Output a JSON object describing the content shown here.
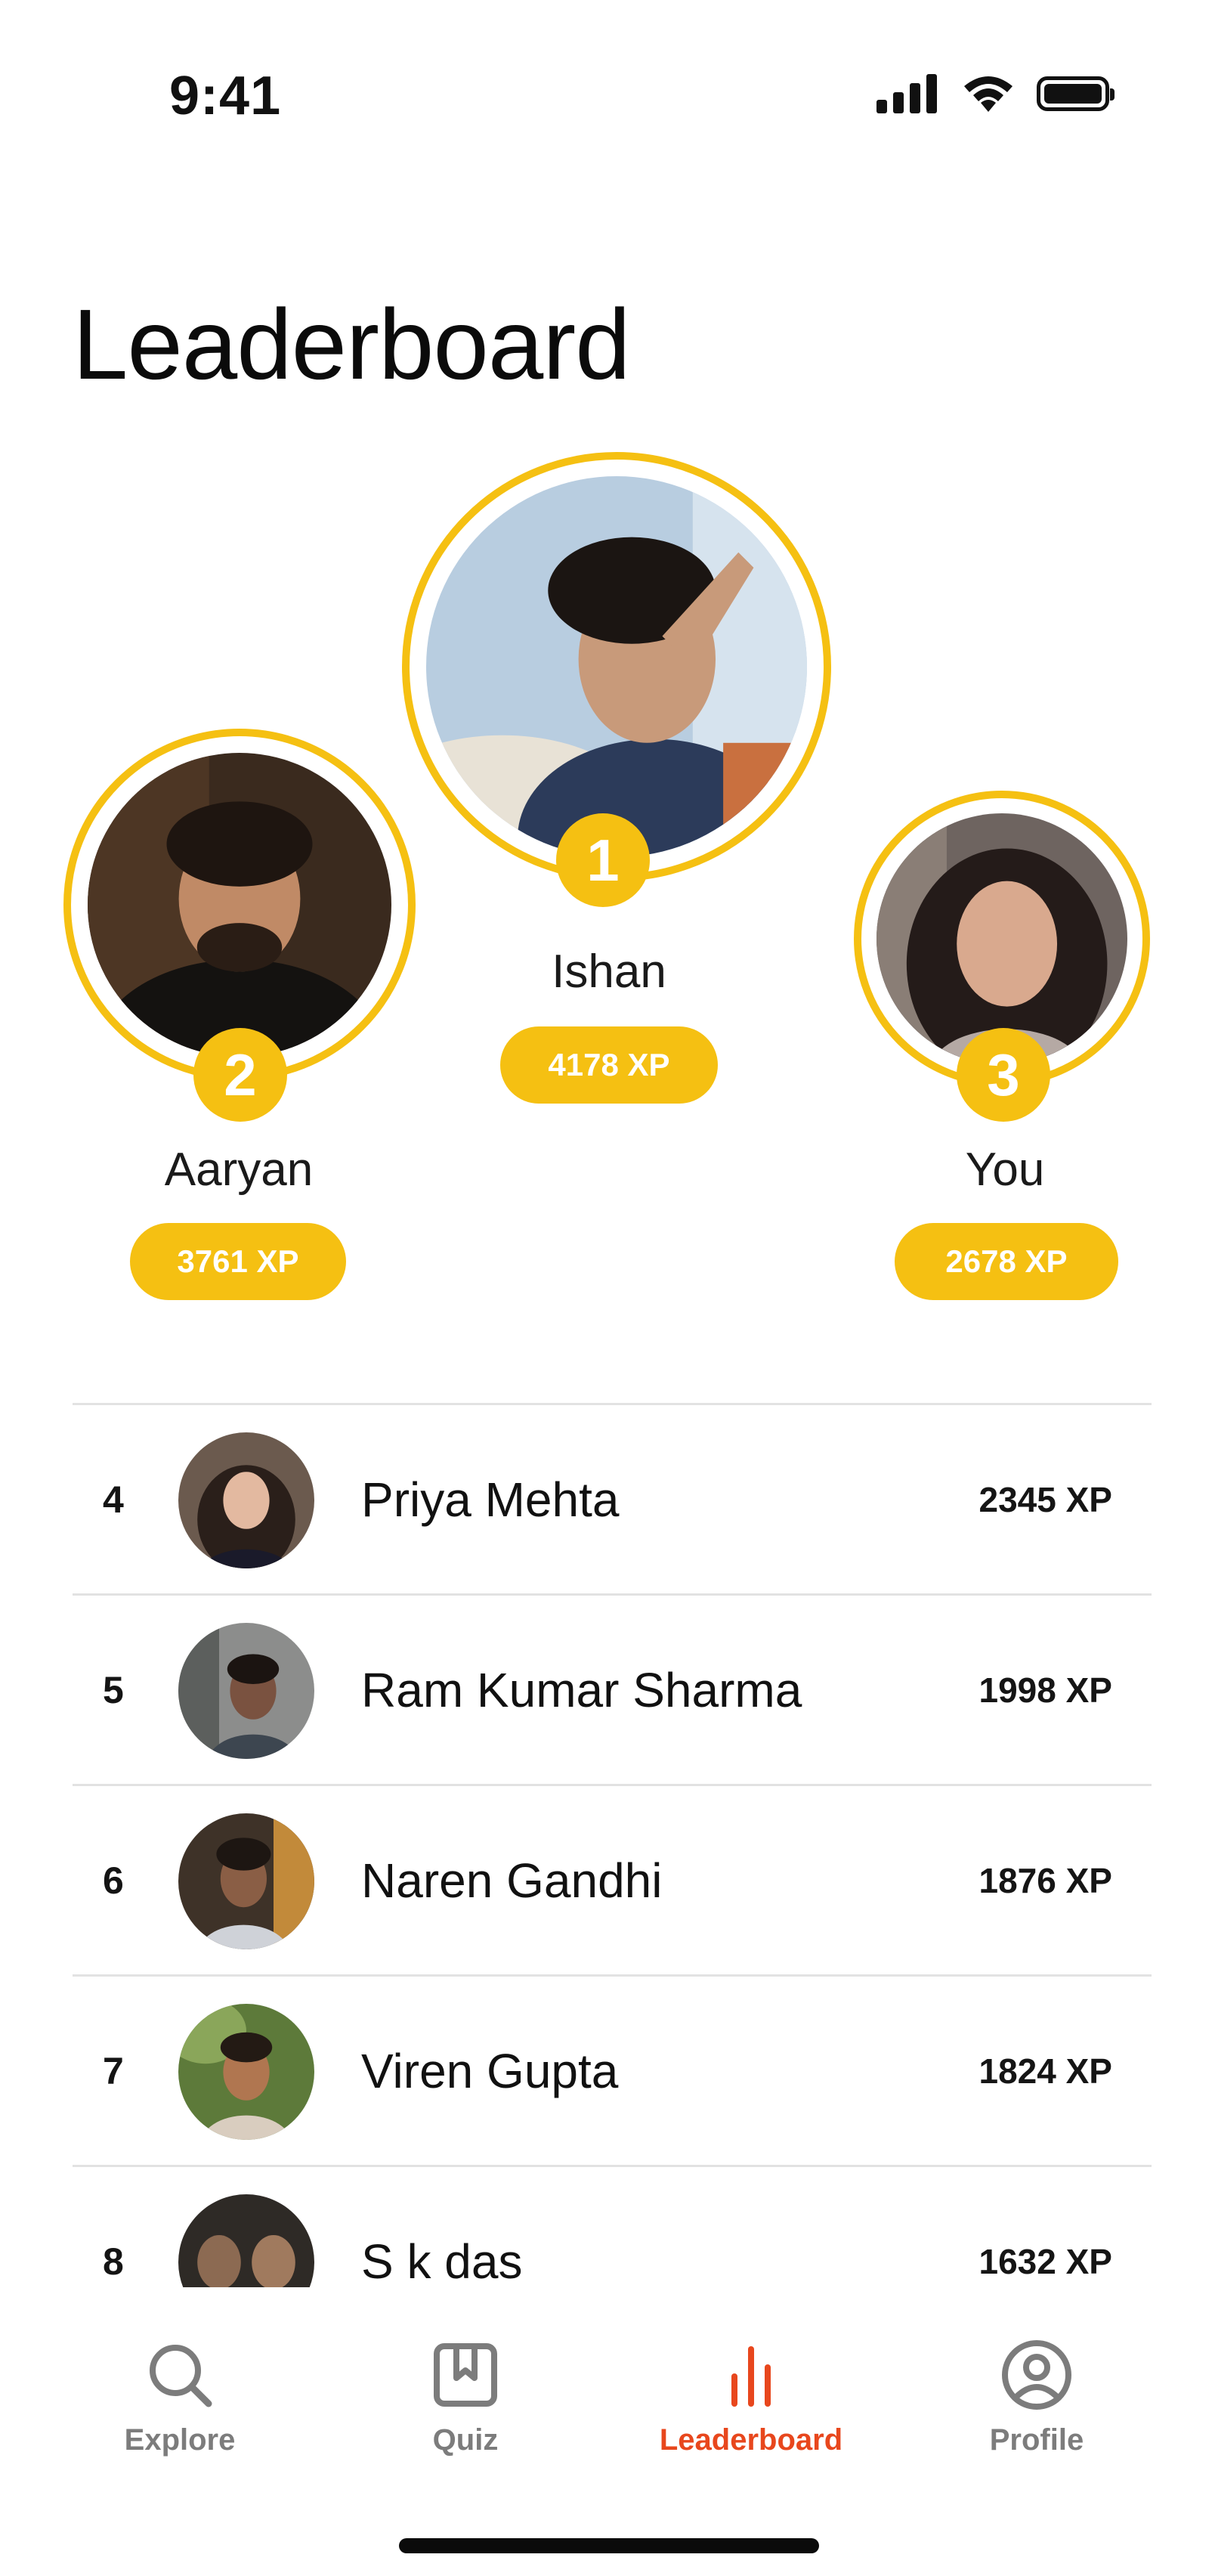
{
  "status_bar": {
    "time": "9:41"
  },
  "page": {
    "title": "Leaderboard"
  },
  "colors": {
    "accent_gold": "#f5c012",
    "active_tab": "#e8471d",
    "inactive_tab": "#7c7c7c"
  },
  "podium": {
    "first": {
      "rank": "1",
      "name": "Ishan",
      "xp": "4178 XP"
    },
    "second": {
      "rank": "2",
      "name": "Aaryan",
      "xp": "3761 XP"
    },
    "third": {
      "rank": "3",
      "name": "You",
      "xp": "2678 XP"
    }
  },
  "list": [
    {
      "rank": "4",
      "name": "Priya Mehta",
      "xp": "2345 XP"
    },
    {
      "rank": "5",
      "name": "Ram Kumar Sharma",
      "xp": "1998 XP"
    },
    {
      "rank": "6",
      "name": "Naren Gandhi",
      "xp": "1876 XP"
    },
    {
      "rank": "7",
      "name": "Viren Gupta",
      "xp": "1824 XP"
    },
    {
      "rank": "8",
      "name": "S k das",
      "xp": "1632 XP"
    }
  ],
  "tabs": [
    {
      "label": "Explore",
      "icon": "search-icon"
    },
    {
      "label": "Quiz",
      "icon": "bookmark-book-icon"
    },
    {
      "label": "Leaderboard",
      "icon": "bar-chart-icon",
      "active": true
    },
    {
      "label": "Profile",
      "icon": "user-circle-icon"
    }
  ]
}
